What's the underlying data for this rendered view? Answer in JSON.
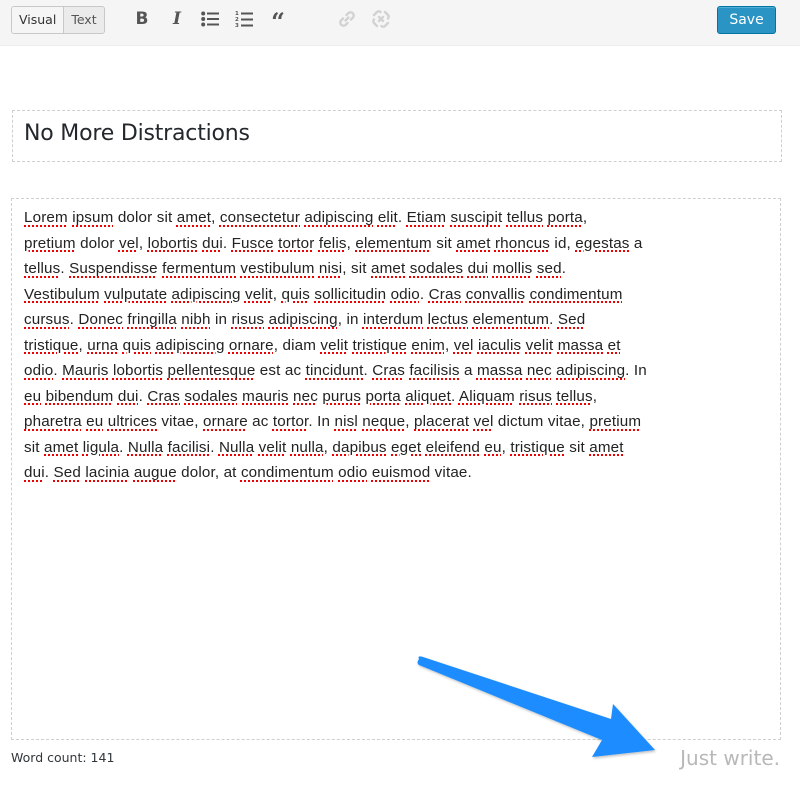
{
  "toolbar": {
    "tabs": [
      {
        "label": "Visual",
        "active": true
      },
      {
        "label": "Text",
        "active": false
      }
    ],
    "icons": {
      "bold": "B",
      "italic": "I",
      "bullet_list": "bullet-list-icon",
      "numbered_list": "numbered-list-icon",
      "blockquote": "“",
      "link": "link-icon",
      "unlink": "unlink-icon"
    },
    "save_label": "Save",
    "save_color": "#2a95c5"
  },
  "editor": {
    "title": "No More Distractions",
    "body_lines": [
      [
        [
          "Lorem",
          1
        ],
        " ",
        [
          "ipsum",
          1
        ],
        " dolor sit ",
        [
          "amet",
          1
        ],
        ", ",
        [
          "consectetur",
          1
        ],
        " ",
        [
          "adipiscing",
          1
        ],
        " ",
        [
          "elit",
          1
        ],
        ". ",
        [
          "Etiam",
          1
        ],
        " ",
        [
          "suscipit",
          1
        ],
        " ",
        [
          "tellus",
          1
        ],
        " ",
        [
          "porta",
          1
        ],
        ","
      ],
      [
        [
          "pretium",
          1
        ],
        " dolor ",
        [
          "vel",
          1
        ],
        ", ",
        [
          "lobortis",
          1
        ],
        " ",
        [
          "dui",
          1
        ],
        ". ",
        [
          "Fusce",
          1
        ],
        " ",
        [
          "tortor",
          1
        ],
        " ",
        [
          "felis",
          1
        ],
        ", ",
        [
          "elementum",
          1
        ],
        " sit ",
        [
          "amet",
          1
        ],
        " ",
        [
          "rhoncus",
          1
        ],
        " id, ",
        [
          "egestas",
          1
        ],
        " a"
      ],
      [
        [
          "tellus",
          1
        ],
        ". ",
        [
          "Suspendisse",
          1
        ],
        " ",
        [
          "fermentum",
          1
        ],
        " ",
        [
          "vestibulum",
          1
        ],
        " ",
        [
          "nisi",
          1
        ],
        ", sit ",
        [
          "amet",
          1
        ],
        " ",
        [
          "sodales",
          1
        ],
        " ",
        [
          "dui",
          1
        ],
        " ",
        [
          "mollis",
          1
        ],
        " ",
        [
          "sed",
          1
        ],
        "."
      ],
      [
        [
          "Vestibulum",
          1
        ],
        " ",
        [
          "vulputate",
          1
        ],
        " ",
        [
          "adipiscing",
          1
        ],
        " ",
        [
          "velit",
          1
        ],
        ", ",
        [
          "quis",
          1
        ],
        " ",
        [
          "sollicitudin",
          1
        ],
        " ",
        [
          "odio",
          1
        ],
        ". ",
        [
          "Cras",
          1
        ],
        " ",
        [
          "convallis",
          1
        ],
        " ",
        [
          "condimentum",
          1
        ]
      ],
      [
        [
          "cursus",
          1
        ],
        ". ",
        [
          "Donec",
          1
        ],
        " ",
        [
          "fringilla",
          1
        ],
        " ",
        [
          "nibh",
          1
        ],
        " in ",
        [
          "risus",
          1
        ],
        " ",
        [
          "adipiscing",
          1
        ],
        ", in ",
        [
          "interdum",
          1
        ],
        " ",
        [
          "lectus",
          1
        ],
        " ",
        [
          "elementum",
          1
        ],
        ". ",
        [
          "Sed",
          1
        ]
      ],
      [
        [
          "tristique",
          1
        ],
        ", ",
        [
          "urna",
          1
        ],
        " ",
        [
          "quis",
          1
        ],
        " ",
        [
          "adipiscing",
          1
        ],
        " ",
        [
          "ornare",
          1
        ],
        ", diam ",
        [
          "velit",
          1
        ],
        " ",
        [
          "tristique",
          1
        ],
        " ",
        [
          "enim",
          1
        ],
        ", ",
        [
          "vel",
          1
        ],
        " ",
        [
          "iaculis",
          1
        ],
        " ",
        [
          "velit",
          1
        ],
        " ",
        [
          "massa",
          1
        ],
        " ",
        [
          "et",
          1
        ]
      ],
      [
        [
          "odio",
          1
        ],
        ". ",
        [
          "Mauris",
          1
        ],
        " ",
        [
          "lobortis",
          1
        ],
        " ",
        [
          "pellentesque",
          1
        ],
        " est ac ",
        [
          "tincidunt",
          1
        ],
        ". ",
        [
          "Cras",
          1
        ],
        " ",
        [
          "facilisis",
          1
        ],
        " a ",
        [
          "massa",
          1
        ],
        " ",
        [
          "nec",
          1
        ],
        " ",
        [
          "adipiscing",
          1
        ],
        ". In"
      ],
      [
        [
          "eu",
          1
        ],
        " ",
        [
          "bibendum",
          1
        ],
        " ",
        [
          "dui",
          1
        ],
        ". ",
        [
          "Cras",
          1
        ],
        " ",
        [
          "sodales",
          1
        ],
        " ",
        [
          "mauris",
          1
        ],
        " ",
        [
          "nec",
          1
        ],
        " ",
        [
          "purus",
          1
        ],
        " ",
        [
          "porta",
          1
        ],
        " ",
        [
          "aliquet",
          1
        ],
        ". ",
        [
          "Aliquam",
          1
        ],
        " ",
        [
          "risus",
          1
        ],
        " ",
        [
          "tellus",
          1
        ],
        ","
      ],
      [
        [
          "pharetra",
          1
        ],
        " ",
        [
          "eu",
          1
        ],
        " ",
        [
          "ultrices",
          1
        ],
        " vitae, ",
        [
          "ornare",
          1
        ],
        " ac ",
        [
          "tortor",
          1
        ],
        ". In ",
        [
          "nisl",
          1
        ],
        " ",
        [
          "neque",
          1
        ],
        ", ",
        [
          "placerat",
          1
        ],
        " ",
        [
          "vel",
          1
        ],
        " dictum vitae, ",
        [
          "pretium",
          1
        ]
      ],
      [
        "sit ",
        [
          "amet",
          1
        ],
        " ",
        [
          "ligula",
          1
        ],
        ". ",
        [
          "Nulla",
          1
        ],
        " ",
        [
          "facilisi",
          1
        ],
        ". ",
        [
          "Nulla",
          1
        ],
        " ",
        [
          "velit",
          1
        ],
        " ",
        [
          "nulla",
          1
        ],
        ", ",
        [
          "dapibus",
          1
        ],
        " ",
        [
          "eget",
          1
        ],
        " ",
        [
          "eleifend",
          1
        ],
        " ",
        [
          "eu",
          1
        ],
        ", ",
        [
          "tristique",
          1
        ],
        " sit ",
        [
          "amet",
          1
        ]
      ],
      [
        [
          "dui",
          1
        ],
        ". ",
        [
          "Sed",
          1
        ],
        " ",
        [
          "lacinia",
          1
        ],
        " ",
        [
          "augue",
          1
        ],
        " dolor, at ",
        [
          "condimentum",
          1
        ],
        " ",
        [
          "odio",
          1
        ],
        " ",
        [
          "euismod",
          1
        ],
        " vitae."
      ]
    ]
  },
  "footer": {
    "word_count": "Word count: 141",
    "tagline": "Just write."
  },
  "annotation": {
    "arrow_color": "#1a8cff",
    "points_to": "tagline"
  }
}
